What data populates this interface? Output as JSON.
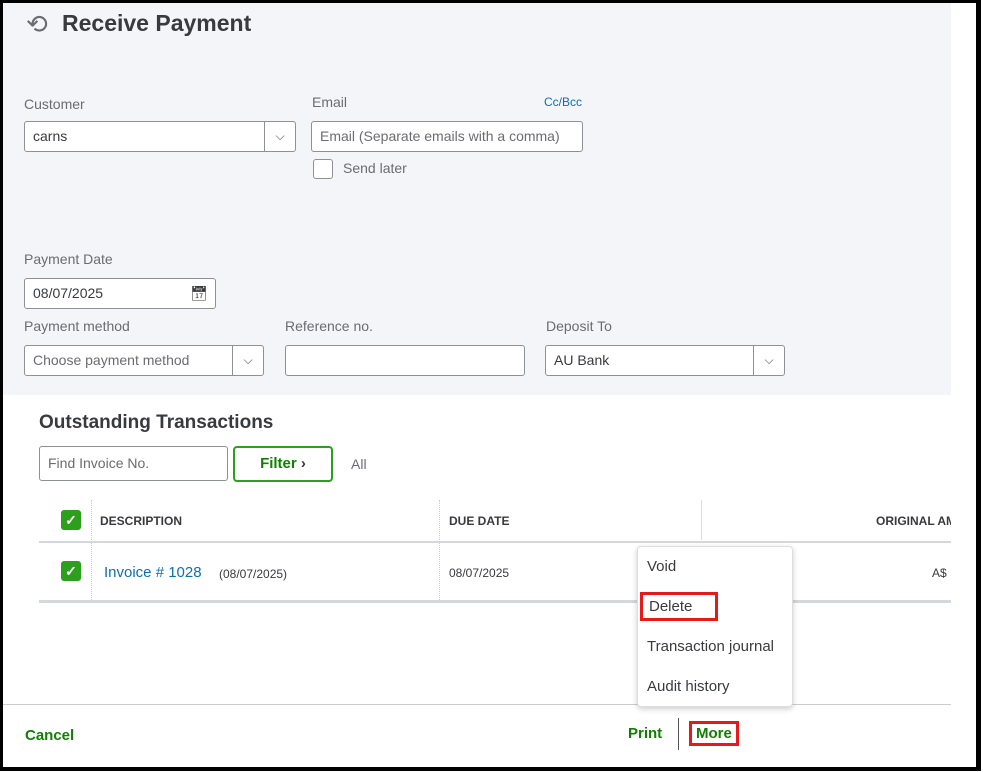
{
  "header": {
    "title": "Receive Payment",
    "icon": "history-icon"
  },
  "customer": {
    "label": "Customer",
    "value": "carns"
  },
  "email": {
    "label": "Email",
    "cc_bcc": "Cc/Bcc",
    "placeholder": "Email (Separate emails with a comma)",
    "send_later": "Send later"
  },
  "payment_date": {
    "label": "Payment Date",
    "value": "08/07/2025"
  },
  "payment_method": {
    "label": "Payment method",
    "placeholder": "Choose payment method"
  },
  "reference": {
    "label": "Reference no.",
    "value": ""
  },
  "deposit_to": {
    "label": "Deposit To",
    "value": "AU Bank"
  },
  "outstanding": {
    "title": "Outstanding Transactions",
    "find_placeholder": "Find Invoice No.",
    "filter": "Filter",
    "all": "All",
    "columns": [
      "DESCRIPTION",
      "DUE DATE",
      "ORIGINAL AM"
    ],
    "rows": [
      {
        "invoice": "Invoice # 1028",
        "date": "(08/07/2025)",
        "due": "08/07/2025",
        "amount": "A$"
      }
    ]
  },
  "menu": {
    "items": [
      "Void",
      "Delete",
      "Transaction journal",
      "Audit history"
    ]
  },
  "footer": {
    "cancel": "Cancel",
    "print": "Print",
    "more": "More"
  }
}
